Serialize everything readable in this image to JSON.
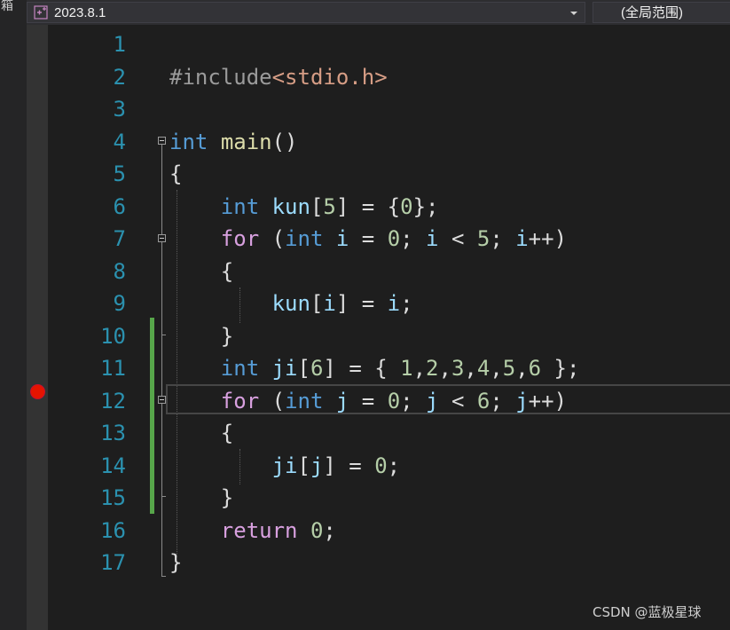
{
  "left_panel": {
    "tab_label": "箱"
  },
  "toolbar": {
    "project_dropdown": {
      "icon": "cpp-project-icon",
      "value": "2023.8.1"
    },
    "scope_dropdown": {
      "value": "(全局范围)"
    }
  },
  "editor": {
    "line_numbers": [
      "1",
      "2",
      "3",
      "4",
      "5",
      "6",
      "7",
      "8",
      "9",
      "10",
      "11",
      "12",
      "13",
      "14",
      "15",
      "16",
      "17"
    ],
    "breakpoint_line": "12",
    "changed_lines": [
      "10",
      "11",
      "12",
      "13",
      "14",
      "15"
    ],
    "lines": [
      [],
      [
        [
          "pre",
          "#include"
        ],
        [
          "str",
          "<stdio.h>"
        ]
      ],
      [],
      [
        [
          "kw",
          "int"
        ],
        [
          "pun",
          " "
        ],
        [
          "fn",
          "main"
        ],
        [
          "pun",
          "()"
        ]
      ],
      [
        [
          "pun",
          "{"
        ]
      ],
      [
        [
          "pun",
          "    "
        ],
        [
          "kw",
          "int"
        ],
        [
          "pun",
          " "
        ],
        [
          "var",
          "kun"
        ],
        [
          "pun",
          "["
        ],
        [
          "num",
          "5"
        ],
        [
          "pun",
          "] = {"
        ],
        [
          "num",
          "0"
        ],
        [
          "pun",
          "};"
        ]
      ],
      [
        [
          "pun",
          "    "
        ],
        [
          "ctl",
          "for"
        ],
        [
          "pun",
          " ("
        ],
        [
          "kw",
          "int"
        ],
        [
          "pun",
          " "
        ],
        [
          "var",
          "i"
        ],
        [
          "pun",
          " = "
        ],
        [
          "num",
          "0"
        ],
        [
          "pun",
          "; "
        ],
        [
          "var",
          "i"
        ],
        [
          "pun",
          " < "
        ],
        [
          "num",
          "5"
        ],
        [
          "pun",
          "; "
        ],
        [
          "var",
          "i"
        ],
        [
          "pun",
          "++)"
        ]
      ],
      [
        [
          "pun",
          "    {"
        ]
      ],
      [
        [
          "pun",
          "        "
        ],
        [
          "var",
          "kun"
        ],
        [
          "pun",
          "["
        ],
        [
          "var",
          "i"
        ],
        [
          "pun",
          "] = "
        ],
        [
          "var",
          "i"
        ],
        [
          "pun",
          ";"
        ]
      ],
      [
        [
          "pun",
          "    }"
        ]
      ],
      [
        [
          "pun",
          "    "
        ],
        [
          "kw",
          "int"
        ],
        [
          "pun",
          " "
        ],
        [
          "var",
          "ji"
        ],
        [
          "pun",
          "["
        ],
        [
          "num",
          "6"
        ],
        [
          "pun",
          "] = { "
        ],
        [
          "num",
          "1"
        ],
        [
          "pun",
          ","
        ],
        [
          "num",
          "2"
        ],
        [
          "pun",
          ","
        ],
        [
          "num",
          "3"
        ],
        [
          "pun",
          ","
        ],
        [
          "num",
          "4"
        ],
        [
          "pun",
          ","
        ],
        [
          "num",
          "5"
        ],
        [
          "pun",
          ","
        ],
        [
          "num",
          "6"
        ],
        [
          "pun",
          " };"
        ]
      ],
      [
        [
          "pun",
          "    "
        ],
        [
          "ctl",
          "for"
        ],
        [
          "pun",
          " ("
        ],
        [
          "kw",
          "int"
        ],
        [
          "pun",
          " "
        ],
        [
          "var",
          "j"
        ],
        [
          "pun",
          " = "
        ],
        [
          "num",
          "0"
        ],
        [
          "pun",
          "; "
        ],
        [
          "var",
          "j"
        ],
        [
          "pun",
          " < "
        ],
        [
          "num",
          "6"
        ],
        [
          "pun",
          "; "
        ],
        [
          "var",
          "j"
        ],
        [
          "pun",
          "++)"
        ]
      ],
      [
        [
          "pun",
          "    {"
        ]
      ],
      [
        [
          "pun",
          "        "
        ],
        [
          "var",
          "ji"
        ],
        [
          "pun",
          "["
        ],
        [
          "var",
          "j"
        ],
        [
          "pun",
          "] = "
        ],
        [
          "num",
          "0"
        ],
        [
          "pun",
          ";"
        ]
      ],
      [
        [
          "pun",
          "    }"
        ]
      ],
      [
        [
          "pun",
          "    "
        ],
        [
          "ctl",
          "return"
        ],
        [
          "pun",
          " "
        ],
        [
          "num",
          "0"
        ],
        [
          "pun",
          ";"
        ]
      ],
      [
        [
          "pun",
          "}"
        ]
      ]
    ]
  },
  "watermark": "CSDN @蓝极星球",
  "colors": {
    "background": "#1e1e1e",
    "line_number": "#2b91af",
    "keyword": "#569cd6",
    "control_keyword": "#d8a0df",
    "function": "#dcdcaa",
    "variable": "#9cdcfe",
    "number": "#b5cea8",
    "preprocessor": "#9b9b9b",
    "include_path": "#d69d85",
    "breakpoint": "#e51400",
    "change_bar": "#57a64a"
  }
}
